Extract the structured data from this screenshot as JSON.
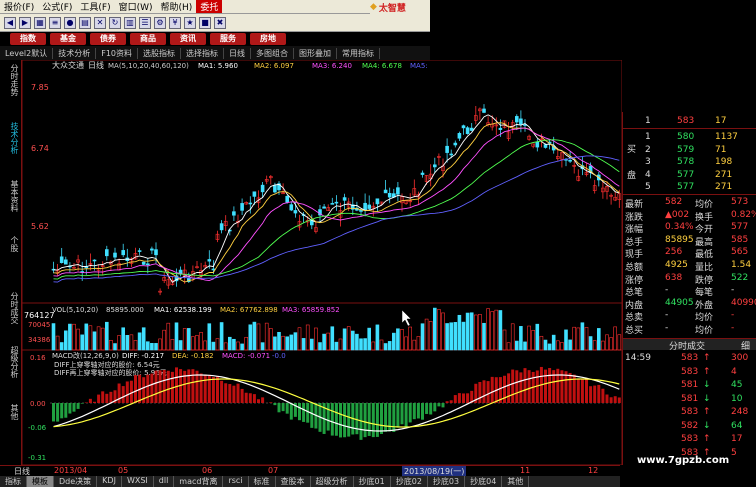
{
  "menu": {
    "items": [
      "报价(F)",
      "公式(F)",
      "工具(F)",
      "窗口(W)",
      "帮助(H)",
      "委托"
    ],
    "active_index": 5
  },
  "logo": {
    "text": "太智慧"
  },
  "toolbar": {
    "icons": [
      "back-icon",
      "forward-icon",
      "tile-icon",
      "sort-icon",
      "color-icon",
      "grid-icon",
      "x-icon",
      "refresh-icon",
      "chart-icon",
      "list-icon",
      "settings-icon",
      "money-icon",
      "star-icon",
      "stop-icon",
      "close-icon"
    ]
  },
  "nav": {
    "buttons": [
      "指数",
      "基金",
      "债券",
      "商品",
      "资讯",
      "服务",
      "房地"
    ]
  },
  "subbar": {
    "items": [
      "Level2默认",
      "技术分析",
      "F10资料",
      "选股指标",
      "选择指标",
      "日线",
      "多图组合",
      "图形叠加",
      "常用指标"
    ]
  },
  "sidetabs": [
    "分时走势",
    "技术分析",
    "基本资料",
    "个股",
    "分时成交",
    "超级分析",
    "其他"
  ],
  "chart_header": {
    "stock": "大众交通",
    "period": "日线",
    "ma_label": "MA(5,10,20,40,60,120)",
    "ma1": "MA1: 5.960",
    "ma2": "MA2: 6.097",
    "ma3": "MA3: 6.240",
    "ma4": "MA4: 6.678",
    "ma5": "MA5:"
  },
  "price_axis": [
    "7.85",
    "6.74",
    "5.62"
  ],
  "vol_header": {
    "label": "VOL(5,10,20)",
    "val": "85895.000",
    "ma1": "MA1: 62538.199",
    "ma2": "MA2: 67762.898",
    "ma3": "MA3: 65859.852"
  },
  "vol_axis": [
    "764127",
    "70045",
    "34386"
  ],
  "macd_header": {
    "label": "MACD改(12,26,9,0)",
    "diff": "DIFF: -0.217",
    "dea": "DEA: -0.182",
    "macd": "MACD: -0.071",
    "extra": "-0.0"
  },
  "macd_notes": [
    "DIFF上穿零轴对应的股价: 6.54元",
    "DIFF再上穿零轴对应的股价: 5.96元"
  ],
  "macd_axis": [
    "0.16",
    "0.00",
    "-0.06",
    "-0.31"
  ],
  "time_axis": [
    "日线",
    "2013/04",
    "05",
    "06",
    "07",
    "2013/08/19(一)",
    "11",
    "12"
  ],
  "bottom_tabs": [
    "指标",
    "模板",
    "Dde决策",
    "KDJ",
    "WXSI",
    "dll",
    "macd背离",
    "rsci",
    "标准",
    "查股本",
    "超级分析",
    "抄底01",
    "抄底02",
    "抄底03",
    "抄底04",
    "其他"
  ],
  "bottom_tab_active": 1,
  "order_book": {
    "ask_label": "卖",
    "bid_label": "买",
    "pan_label": "盘",
    "asks": [
      {
        "level": "1",
        "price": "583",
        "qty": "17"
      }
    ],
    "bids": [
      {
        "level": "1",
        "price": "580",
        "qty": "1137"
      },
      {
        "level": "2",
        "price": "579",
        "qty": "71"
      },
      {
        "level": "3",
        "price": "578",
        "qty": "198"
      },
      {
        "level": "4",
        "price": "577",
        "qty": "271"
      },
      {
        "level": "5",
        "price": "577",
        "qty": "271"
      }
    ]
  },
  "quote": [
    {
      "k1": "最新",
      "v1": "582",
      "k2": "均价",
      "v2": "573"
    },
    {
      "k1": "涨跌",
      "v1": "▲002",
      "k2": "换手",
      "v2": "0.82%"
    },
    {
      "k1": "涨幅",
      "v1": "0.34%",
      "k2": "今开",
      "v2": "577"
    },
    {
      "k1": "总手",
      "v1": "85895",
      "k2": "最高",
      "v2": "585"
    },
    {
      "k1": "现手",
      "v1": "256",
      "k2": "最低",
      "v2": "565"
    },
    {
      "k1": "总额",
      "v1": "4925",
      "k2": "量比",
      "v2": "1.54"
    },
    {
      "k1": "涨停",
      "v1": "638",
      "k2": "跌停",
      "v2": "522"
    },
    {
      "k1": "总笔",
      "v1": "-",
      "k2": "每笔",
      "v2": "-"
    },
    {
      "k1": "内盘",
      "v1": "44905",
      "k2": "外盘",
      "v2": "40990"
    },
    {
      "k1": "总卖",
      "v1": "-",
      "k2": "均价",
      "v2": "-"
    },
    {
      "k1": "总买",
      "v1": "-",
      "k2": "均价",
      "v2": "-"
    }
  ],
  "trades_header": {
    "title": "分时成交",
    "tab": "细"
  },
  "trades": [
    {
      "time": "14:59",
      "price": "583",
      "dir": "↑",
      "qty": "300"
    },
    {
      "time": "",
      "price": "583",
      "dir": "↑",
      "qty": "4"
    },
    {
      "time": "",
      "price": "581",
      "dir": "↓",
      "qty": "45"
    },
    {
      "time": "",
      "price": "581",
      "dir": "↓",
      "qty": "10"
    },
    {
      "time": "",
      "price": "583",
      "dir": "↑",
      "qty": "248"
    },
    {
      "time": "",
      "price": "582",
      "dir": "↓",
      "qty": "64"
    },
    {
      "time": "",
      "price": "583",
      "dir": "↑",
      "qty": "17"
    },
    {
      "time": "",
      "price": "583",
      "dir": "↑",
      "qty": "5"
    }
  ],
  "watermark": "www.7gpzb.com",
  "colors": {
    "up": "#ff4040",
    "down": "#30e060",
    "frame": "#7a1010",
    "macd_pos": "#c01010",
    "macd_neg": "#20a040"
  }
}
